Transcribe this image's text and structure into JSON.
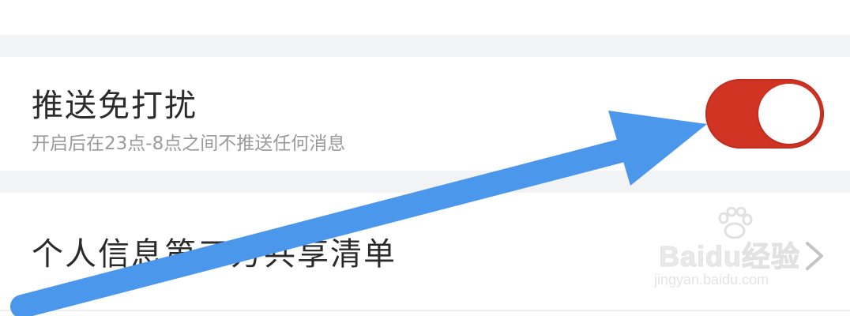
{
  "settings": {
    "do_not_disturb": {
      "title": "推送免打扰",
      "subtitle": "开启后在23点-8点之间不推送任何消息",
      "enabled": true,
      "toggle_color": "#d23424"
    },
    "share_list": {
      "label": "个人信息第三方共享清单",
      "icon": "chevron-right-icon"
    }
  },
  "watermark": {
    "logo": "Baidu经验",
    "url": "jingyan.baidu.com"
  },
  "annotation": {
    "arrow_color": "#4a97ec"
  }
}
